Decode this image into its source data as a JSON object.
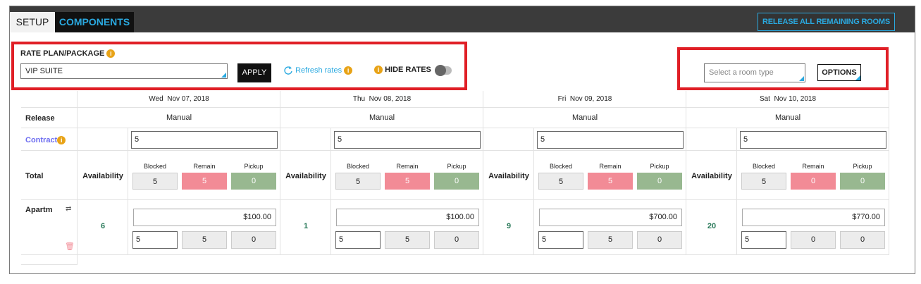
{
  "tabs": {
    "setup": "SETUP",
    "components": "COMPONENTS"
  },
  "release_button": "RELEASE ALL REMAINING ROOMS",
  "rate_plan": {
    "label": "RATE PLAN/PACKAGE",
    "value": "VIP SUITE",
    "apply": "APPLY",
    "refresh": "Refresh rates",
    "hide_rates": "HIDE RATES"
  },
  "room_type": {
    "placeholder": "Select a room type",
    "options": "OPTIONS"
  },
  "row_labels": {
    "release": "Release",
    "contract": "Contract",
    "total": "Total",
    "room": "Apartm"
  },
  "labels": {
    "availability": "Availability",
    "blocked": "Blocked",
    "remain": "Remain",
    "pickup": "Pickup"
  },
  "days": [
    {
      "day": "Wed",
      "date": "Nov 07, 2018",
      "release": "Manual",
      "contract": "5",
      "blocked": "5",
      "remain": "5",
      "pickup": "0",
      "room_avail": "6",
      "rate": "$100.00",
      "room_block": "5",
      "room_remain": "5",
      "room_pickup": "0"
    },
    {
      "day": "Thu",
      "date": "Nov 08, 2018",
      "release": "Manual",
      "contract": "5",
      "blocked": "5",
      "remain": "5",
      "pickup": "0",
      "room_avail": "1",
      "rate": "$100.00",
      "room_block": "5",
      "room_remain": "5",
      "room_pickup": "0"
    },
    {
      "day": "Fri",
      "date": "Nov 09, 2018",
      "release": "Manual",
      "contract": "5",
      "blocked": "5",
      "remain": "5",
      "pickup": "0",
      "room_avail": "9",
      "rate": "$700.00",
      "room_block": "5",
      "room_remain": "5",
      "room_pickup": "0"
    },
    {
      "day": "Sat",
      "date": "Nov 10, 2018",
      "release": "Manual",
      "contract": "5",
      "blocked": "5",
      "remain": "0",
      "pickup": "0",
      "room_avail": "20",
      "rate": "$770.00",
      "room_block": "5",
      "room_remain": "0",
      "room_pickup": "0"
    }
  ],
  "colors": {
    "accent": "#2aa9e0",
    "highlight": "#e01f26",
    "remain": "#f28b96",
    "pickup": "#98b890",
    "info": "#e8a317"
  },
  "icons": {
    "info": "info-icon",
    "refresh": "refresh-icon",
    "swap": "swap-icon",
    "trash": "trash-icon"
  }
}
